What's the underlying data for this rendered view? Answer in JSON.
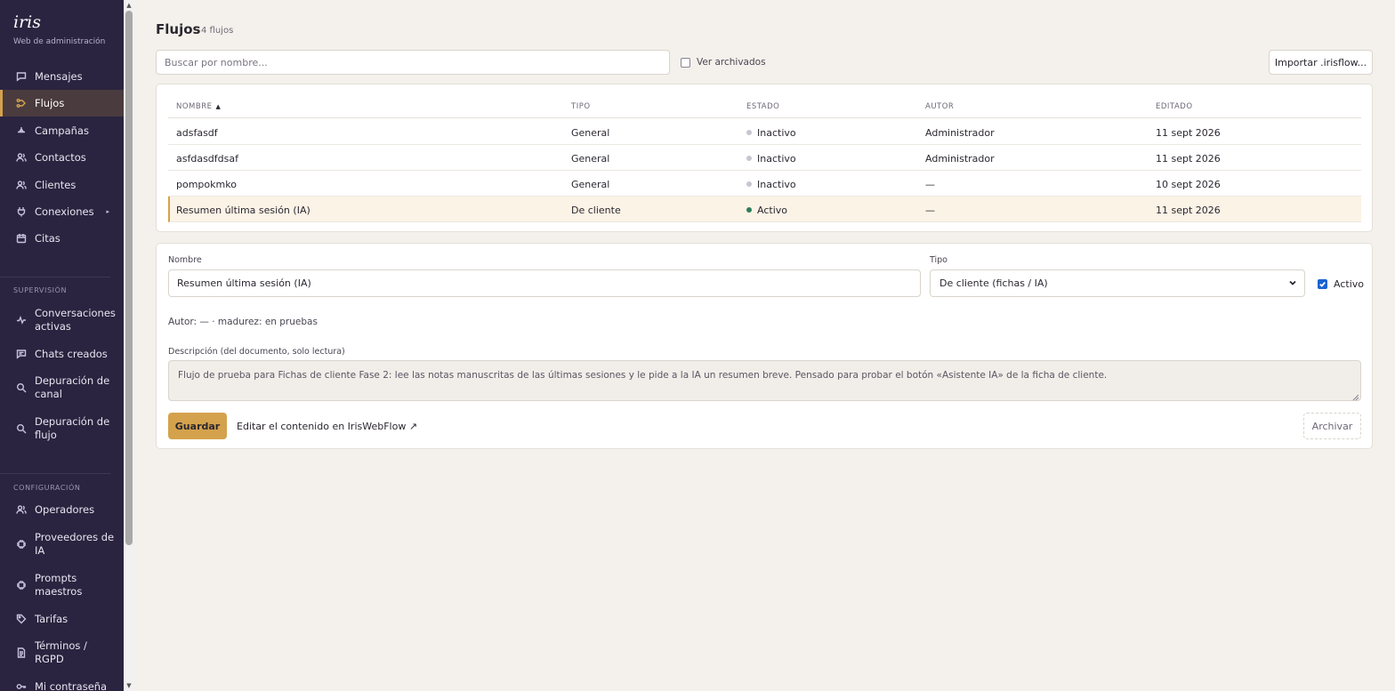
{
  "brand": {
    "logo": "iris",
    "subtitle": "Web de administración"
  },
  "nav": {
    "main": [
      {
        "label": "Mensajes",
        "icon": "chat-icon"
      },
      {
        "label": "Flujos",
        "icon": "flow-icon",
        "active": true
      },
      {
        "label": "Campañas",
        "icon": "megaphone-icon"
      },
      {
        "label": "Contactos",
        "icon": "users-icon"
      },
      {
        "label": "Clientes",
        "icon": "users-icon"
      },
      {
        "label": "Conexiones",
        "icon": "plug-icon",
        "chevron": "▸"
      },
      {
        "label": "Citas",
        "icon": "calendar-icon"
      }
    ],
    "supervision_title": "SUPERVISIÓN",
    "supervision": [
      {
        "label": "Conversaciones activas",
        "icon": "activity-icon"
      },
      {
        "label": "Chats creados",
        "icon": "chat-icon"
      },
      {
        "label": "Depuración de canal",
        "icon": "search-icon"
      },
      {
        "label": "Depuración de flujo",
        "icon": "search-icon"
      }
    ],
    "config_title": "CONFIGURACIÓN",
    "config": [
      {
        "label": "Operadores",
        "icon": "users-icon"
      },
      {
        "label": "Proveedores de IA",
        "icon": "chip-icon"
      },
      {
        "label": "Prompts maestros",
        "icon": "chip-icon"
      },
      {
        "label": "Tarifas",
        "icon": "tag-icon"
      },
      {
        "label": "Términos / RGPD",
        "icon": "document-icon"
      },
      {
        "label": "Mi contraseña",
        "icon": "key-icon"
      }
    ]
  },
  "header": {
    "title": "Flujos",
    "count": "4 flujos"
  },
  "toolbar": {
    "search_placeholder": "Buscar por nombre...",
    "archived_label": "Ver archivados",
    "import_label": "Importar .irisflow..."
  },
  "table": {
    "columns": {
      "name": "NOMBRE",
      "sort_indicator": "▲",
      "type": "TIPO",
      "status": "ESTADO",
      "author": "AUTOR",
      "edited": "EDITADO"
    },
    "rows": [
      {
        "name": "adsfasdf",
        "type": "General",
        "status": "Inactivo",
        "author": "Administrador",
        "edited": "11 sept 2026"
      },
      {
        "name": "asfdasdfdsaf",
        "type": "General",
        "status": "Inactivo",
        "author": "Administrador",
        "edited": "11 sept 2026"
      },
      {
        "name": "pompokmko",
        "type": "General",
        "status": "Inactivo",
        "author": "—",
        "edited": "10 sept 2026"
      },
      {
        "name": "Resumen última sesión (IA)",
        "type": "De cliente",
        "status": "Activo",
        "author": "—",
        "edited": "11 sept 2026",
        "selected": true
      }
    ]
  },
  "colors": {
    "accent": "#d4a24c",
    "status_active": "#2e7d5b",
    "status_inactive": "#c9c5cf",
    "sidebar_bg": "#2a2440"
  },
  "detail": {
    "name_label": "Nombre",
    "name_value": "Resumen última sesión (IA)",
    "type_label": "Tipo",
    "type_value": "De cliente (fichas / IA)",
    "active_label": "Activo",
    "meta": "Autor: — · madurez: en pruebas",
    "description_label": "Descripción (del documento, solo lectura)",
    "description": "Flujo de prueba para Fichas de cliente Fase 2: lee las notas manuscritas de las últimas sesiones y le pide a la IA un resumen breve. Pensado para probar el botón «Asistente IA» de la ficha de cliente.",
    "save_label": "Guardar",
    "edit_link": "Editar el contenido en IrisWebFlow ↗",
    "archive_label": "Archivar"
  }
}
